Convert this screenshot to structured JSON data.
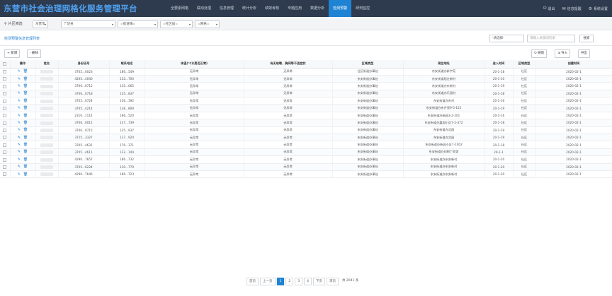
{
  "header": {
    "title": "东营市社会治理网格化服务管理平台",
    "nav": [
      "全要素网格",
      "联动处理",
      "信息管理",
      "统计分析",
      "绩效考核",
      "专题应用",
      "数据分析",
      "检测预警",
      "研判监控"
    ],
    "active_nav": 7,
    "right": [
      "退出",
      "信息提醒",
      "系统设置"
    ]
  },
  "filter": {
    "label": "片区筛选",
    "region": "东营市",
    "district": "广饶县",
    "street": "=街道镇=",
    "community": "=社区居=",
    "grid": "=网格="
  },
  "panel": {
    "title": "检测预警信息管理列表",
    "search_field": "-请选择-",
    "search_placeholder": "请输入关键词检索",
    "search_button": "搜索"
  },
  "toolbar": {
    "add": "+ 新增",
    "delete": "- 删除",
    "refresh": "刷新",
    "import": "导入",
    "export": "导出"
  },
  "table": {
    "headers": [
      "",
      "操作",
      "姓名",
      "身份证号",
      "联系电话",
      "体温(℃)(是否正常)",
      "有无咳嗽、胸闷等不适症状",
      "区域类型",
      "现住地址",
      "进入时间",
      "区域类型",
      "创建时间"
    ],
    "rows": [
      [
        "3705...0023",
        "186...549",
        "无异常",
        "无异常",
        "社区街道办事处",
        "东安街道办新宇苑",
        "20-1-18",
        "社区",
        "2020-02-1"
      ],
      [
        "4205...4040",
        "132...700",
        "无异常",
        "无异常",
        "东安街道办事处",
        "东安街道稻庄新村",
        "20-1-10",
        "社区",
        "2020-02-1"
      ],
      [
        "3706...0715",
        "135...065",
        "无异常",
        "无异常",
        "东安街道办事处",
        "东安街道办东新村",
        "20-1-19",
        "社区",
        "2020-02-1"
      ],
      [
        "3706...0718",
        "135...837",
        "无异常",
        "无异常",
        "东安街道办事处",
        "东安街道办乐园村",
        "20-1-18",
        "社区",
        "2020-02-1"
      ],
      [
        "3705...0724",
        "136...192",
        "无异常",
        "无异常",
        "东安街道办事处",
        "东安街道办东村",
        "20-1-16",
        "社区",
        "2020-02-1"
      ],
      [
        "3705...4214",
        "138...809",
        "无异常",
        "无异常",
        "东安街道办事处",
        "东安街道办东升苑9-5-121",
        "20-1-19",
        "社区",
        "2020-02-1"
      ],
      [
        "2310...1114",
        "186...520",
        "无异常",
        "无异常",
        "东安街道办事处",
        "东安街道办新园3-2-201",
        "20-1-16",
        "社区",
        "2020-02-1"
      ],
      [
        "3706...0012",
        "137...739",
        "无异常",
        "无异常",
        "东安街道办事处",
        "东安街道办嘉园小区7-2-372",
        "20-1-18",
        "社区",
        "2020-02-1"
      ],
      [
        "3706...0715",
        "135...937",
        "无异常",
        "无异常",
        "东安街道办事处",
        "东安街道办北园",
        "20-1-19",
        "社区",
        "2020-02-1"
      ],
      [
        "3725...3327",
        "137...920",
        "无异常",
        "无异常",
        "东安街道办事处",
        "东安街道办北园",
        "20-1-19",
        "社区",
        "2020-02-1"
      ],
      [
        "3705...4631",
        "176...371",
        "无异常",
        "无异常",
        "东安街道办事处",
        "东安街道办新园小区7-1002",
        "20-1-18",
        "社区",
        "2020-02-1"
      ],
      [
        "3705...4611",
        "132...144",
        "无异常",
        "无异常",
        "东安街道办事处",
        "东安街道办印刷厂宿舍",
        "20-1-1",
        "社区",
        "2020-02-1"
      ],
      [
        "4290...7657",
        "186...732",
        "无异常",
        "无异常",
        "东安街道办事处",
        "东安街道办东安新村",
        "20-1-20",
        "社区",
        "2020-02-1"
      ],
      [
        "3705...6224",
        "130...779",
        "无异常",
        "无异常",
        "东安街道办事处",
        "东安街道办东安新村",
        "20-1-20",
        "社区",
        "2020-02-1"
      ],
      [
        "4290...7646",
        "186...723",
        "无异常",
        "无异常",
        "东安街道办事处",
        "东安街道办东安新村",
        "20-1-20",
        "社区",
        "2020-02-1"
      ]
    ]
  },
  "pager": {
    "first": "首页",
    "prev": "上一页",
    "pages": [
      "1",
      "2",
      "3",
      "4"
    ],
    "active": 0,
    "next": "下页",
    "last": "末页",
    "total": "共 2041 条"
  }
}
